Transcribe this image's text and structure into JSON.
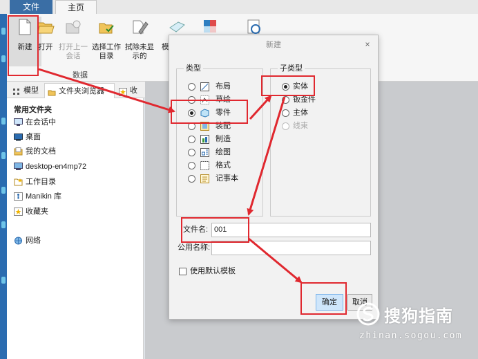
{
  "ribbon": {
    "tabs": [
      {
        "label": "文件"
      },
      {
        "label": "主页"
      }
    ],
    "buttons": [
      {
        "label": "新建"
      },
      {
        "label": "打开"
      },
      {
        "label": "打开上一\n会话"
      },
      {
        "label": "选择工作\n目录"
      },
      {
        "label": "拭除未显\n示的"
      },
      {
        "label": "模"
      }
    ],
    "group_label": "数据"
  },
  "panel": {
    "tabs": [
      {
        "label": "模型"
      },
      {
        "label": "文件夹浏览器"
      },
      {
        "label": "收藏"
      }
    ],
    "title": "常用文件夹",
    "items": [
      {
        "label": "在会话中"
      },
      {
        "label": "桌面"
      },
      {
        "label": "我的文档"
      },
      {
        "label": "desktop-en4mp72"
      },
      {
        "label": "工作目录"
      },
      {
        "label": "Manikin 库"
      },
      {
        "label": "收藏夹"
      },
      {
        "label": "网络"
      }
    ]
  },
  "dialog": {
    "title": "新建",
    "close": "×",
    "type_group": {
      "label": "类型",
      "options": [
        {
          "label": "布局",
          "selected": false,
          "icon": "layout-icon"
        },
        {
          "label": "草绘",
          "selected": false,
          "icon": "sketch-icon"
        },
        {
          "label": "零件",
          "selected": true,
          "icon": "part-icon"
        },
        {
          "label": "装配",
          "selected": false,
          "icon": "assembly-icon"
        },
        {
          "label": "制造",
          "selected": false,
          "icon": "manufacturing-icon"
        },
        {
          "label": "绘图",
          "selected": false,
          "icon": "drawing-icon"
        },
        {
          "label": "格式",
          "selected": false,
          "icon": "format-icon"
        },
        {
          "label": "记事本",
          "selected": false,
          "icon": "notebook-icon"
        }
      ]
    },
    "subtype_group": {
      "label": "子类型",
      "options": [
        {
          "label": "实体",
          "selected": true,
          "enabled": true
        },
        {
          "label": "钣金件",
          "selected": false,
          "enabled": true
        },
        {
          "label": "主体",
          "selected": false,
          "enabled": true
        },
        {
          "label": "线束",
          "selected": false,
          "enabled": false
        }
      ]
    },
    "filename_label": "文件名:",
    "filename_value": "001",
    "common_name_label": "公用名称:",
    "common_name_value": "",
    "default_template_label": "使用默认模板",
    "default_template_checked": false,
    "ok_label": "确定",
    "cancel_label": "取消"
  },
  "watermark": {
    "brand": "搜狗指南",
    "url": "zhinan.sogou.com"
  },
  "colors": {
    "accent": "#3a6ea5",
    "annotation": "#e0282f",
    "ok_button": "#cfe6fb"
  }
}
